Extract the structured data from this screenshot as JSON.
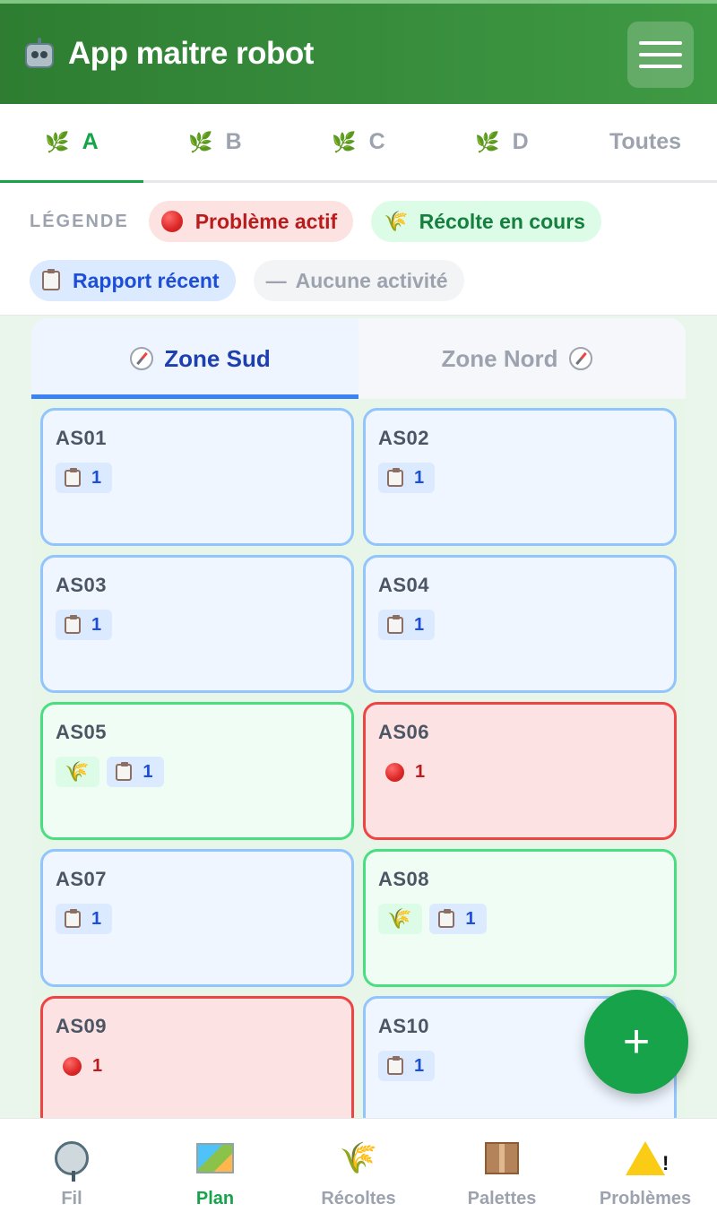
{
  "header": {
    "title": "App maitre robot",
    "icon": "robot-icon",
    "menu_icon": "hamburger-menu-icon"
  },
  "sector_tabs": [
    {
      "label": "A",
      "icon": "leaf-icon",
      "active": true
    },
    {
      "label": "B",
      "icon": "leaf-icon",
      "active": false
    },
    {
      "label": "C",
      "icon": "leaf-icon",
      "active": false
    },
    {
      "label": "D",
      "icon": "leaf-icon",
      "active": false
    },
    {
      "label": "Toutes",
      "active": false
    }
  ],
  "legend": {
    "title": "LÉGENDE",
    "problem": "Problème actif",
    "harvest": "Récolte en cours",
    "report": "Rapport récent",
    "none": "Aucune activité",
    "none_prefix": "—"
  },
  "zones": {
    "sud": "Zone Sud",
    "nord": "Zone Nord"
  },
  "cells": [
    {
      "name": "AS01",
      "report": "1"
    },
    {
      "name": "AS02",
      "report": "1"
    },
    {
      "name": "AS03",
      "report": "1"
    },
    {
      "name": "AS04",
      "report": "1"
    },
    {
      "name": "AS05",
      "report": "1"
    },
    {
      "name": "AS06",
      "problem": "1"
    },
    {
      "name": "AS07",
      "report": "1"
    },
    {
      "name": "AS08",
      "report": "1"
    },
    {
      "name": "AS09",
      "problem": "1"
    },
    {
      "name": "AS10",
      "report": "1"
    }
  ],
  "fab": {
    "label": "+"
  },
  "bottom_nav": [
    {
      "label": "Fil",
      "icon": "satellite-dish-icon"
    },
    {
      "label": "Plan",
      "icon": "map-icon",
      "active": true
    },
    {
      "label": "Récoltes",
      "icon": "wheat-icon"
    },
    {
      "label": "Palettes",
      "icon": "package-icon"
    },
    {
      "label": "Problèmes",
      "icon": "warning-icon"
    }
  ],
  "colors": {
    "primary_green": "#16a34a",
    "header_green": "#2e7d32",
    "blue_accent": "#3b82f6",
    "red_accent": "#ef4444"
  }
}
